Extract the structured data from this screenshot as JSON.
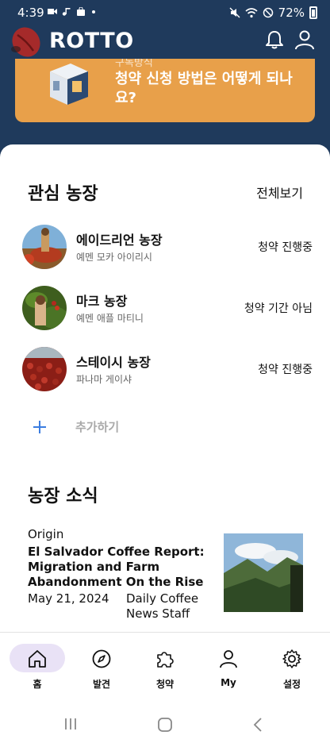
{
  "status_bar": {
    "time": "4:39",
    "battery": "72%"
  },
  "app": {
    "logo_text": "ROTTO"
  },
  "banner": {
    "subtitle": "구독방식",
    "title": "청약 신청 방법은 어떻게 되나요?"
  },
  "favorites": {
    "title": "관심 농장",
    "see_all": "전체보기",
    "farms": [
      {
        "name": "에이드리언 농장",
        "origin": "예멘 모카 아이리시",
        "status": "청약 진행중"
      },
      {
        "name": "마크 농장",
        "origin": "예멘 애플 마티니",
        "status": "청약 기간 아님"
      },
      {
        "name": "스테이시 농장",
        "origin": "파나마 게이샤",
        "status": "청약 진행중"
      }
    ],
    "add_label": "추가하기"
  },
  "news": {
    "title": "농장 소식",
    "items": [
      {
        "category": "Origin",
        "title": "El Salvador Coffee Report: Migration and Farm Abandonment On the Rise",
        "date": "May 21, 2024",
        "author": "Daily Coffee News Staff"
      }
    ]
  },
  "bottom_nav": [
    {
      "label": "홈",
      "icon": "home-icon",
      "active": true
    },
    {
      "label": "발견",
      "icon": "compass-icon",
      "active": false
    },
    {
      "label": "청약",
      "icon": "puzzle-icon",
      "active": false
    },
    {
      "label": "My",
      "icon": "person-icon",
      "active": false
    },
    {
      "label": "설정",
      "icon": "gear-icon",
      "active": false
    }
  ],
  "colors": {
    "header_bg": "#1f3a5c",
    "banner_bg": "#e8a04a",
    "nav_active_bg": "#e9e2f6",
    "accent_plus": "#3b7de0"
  }
}
